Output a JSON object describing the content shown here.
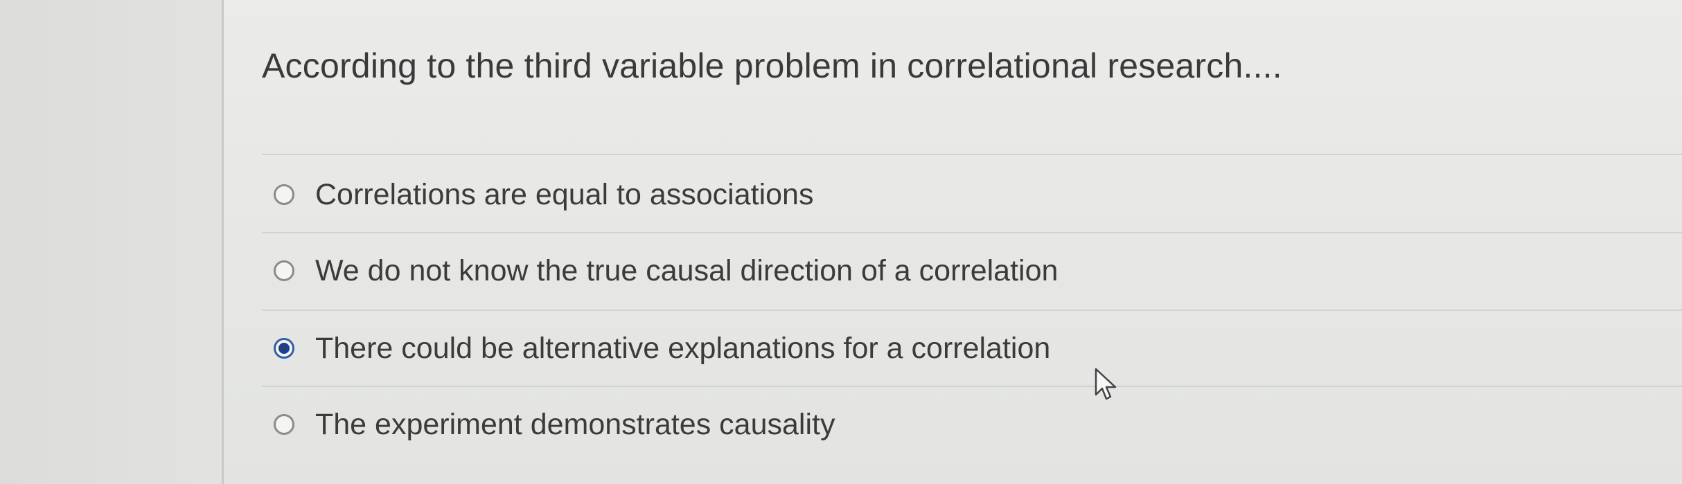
{
  "question": {
    "text": "According to the third variable problem in correlational research...."
  },
  "options": [
    {
      "label": "Correlations are equal to associations",
      "selected": false
    },
    {
      "label": "We do not know the true causal direction of a correlation",
      "selected": false
    },
    {
      "label": "There could be alternative explanations for a correlation",
      "selected": true
    },
    {
      "label": "The experiment demonstrates causality",
      "selected": false
    }
  ],
  "colors": {
    "selected_radio": "#1f3f86",
    "text": "#3b3b3b",
    "background": "#e6e7e5"
  },
  "icons": {
    "cursor": "mouse-pointer-icon"
  }
}
